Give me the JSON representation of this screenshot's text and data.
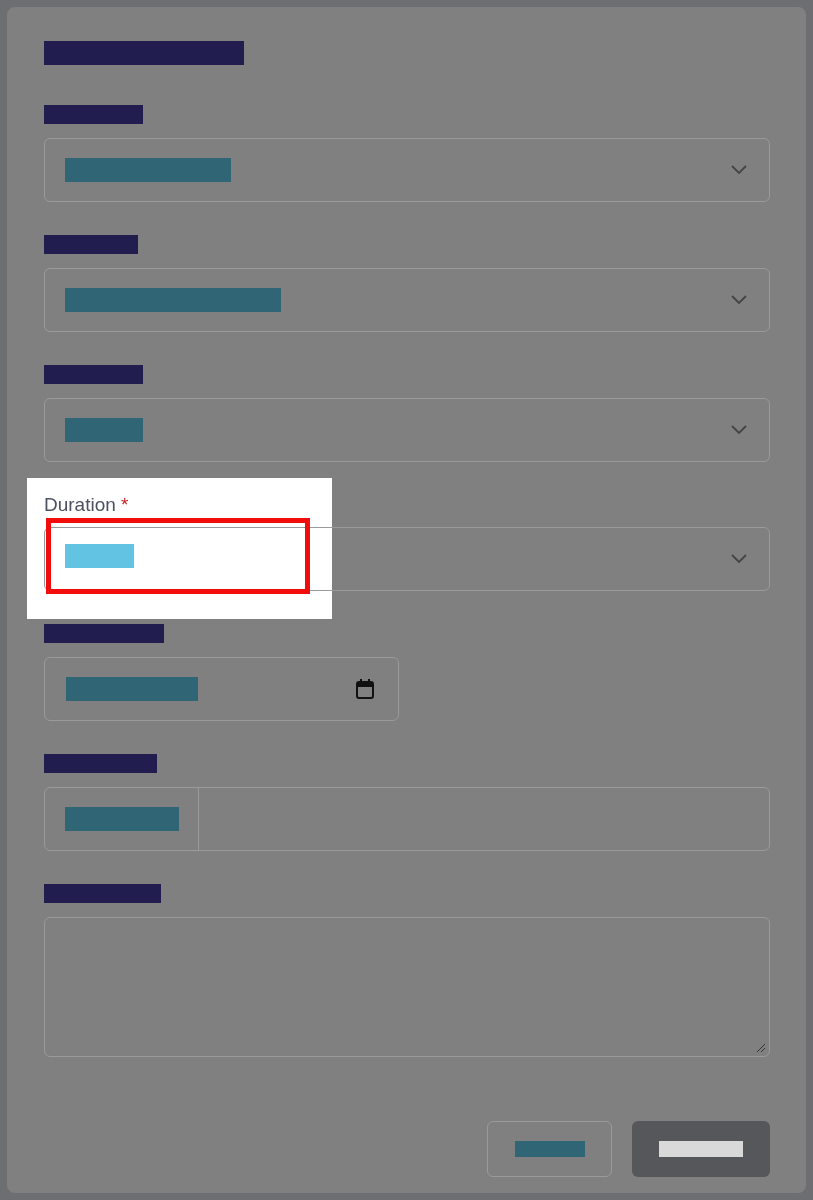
{
  "dialog": {
    "fields": [
      {
        "kind": "select"
      },
      {
        "kind": "select"
      },
      {
        "kind": "select"
      },
      {
        "kind": "select",
        "label": "Duration",
        "required_mark": "*",
        "highlighted": true
      },
      {
        "kind": "date"
      },
      {
        "kind": "addon"
      },
      {
        "kind": "textarea"
      }
    ]
  },
  "buttons": [
    {
      "kind": "secondary"
    },
    {
      "kind": "primary"
    }
  ]
}
